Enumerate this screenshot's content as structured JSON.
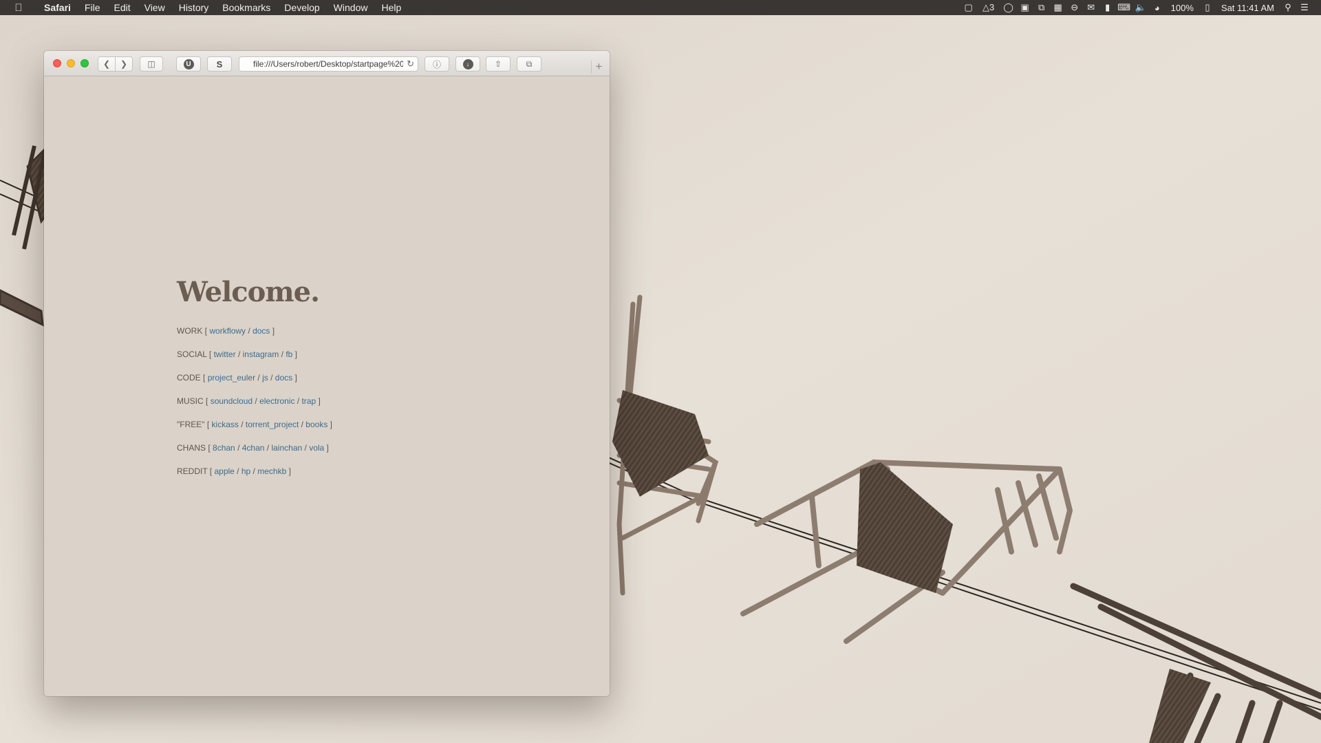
{
  "menubar": {
    "app": "Safari",
    "items": [
      "File",
      "Edit",
      "View",
      "History",
      "Bookmarks",
      "Develop",
      "Window",
      "Help"
    ],
    "status": {
      "badge_count": "3",
      "battery": "100%",
      "clock": "Sat 11:41 AM"
    }
  },
  "browser": {
    "url": "file:///Users/robert/Desktop/startpage%20crea",
    "toolbar_buttons": {
      "ublock": "U",
      "stylebot": "S"
    },
    "new_tab": "+"
  },
  "startpage": {
    "title": "Welcome.",
    "sections": [
      {
        "label": "WORK",
        "links": [
          "workflowy",
          "docs"
        ]
      },
      {
        "label": "SOCIAL",
        "links": [
          "twitter",
          "instagram",
          "fb"
        ]
      },
      {
        "label": "CODE",
        "links": [
          "project_euler",
          "js",
          "docs"
        ]
      },
      {
        "label": "MUSIC",
        "links": [
          "soundcloud",
          "electronic",
          "trap"
        ]
      },
      {
        "label": "\"FREE\"",
        "links": [
          "kickass",
          "torrent_project",
          "books"
        ]
      },
      {
        "label": "CHANS",
        "links": [
          "8chan",
          "4chan",
          "lainchan",
          "vola"
        ]
      },
      {
        "label": "REDDIT",
        "links": [
          "apple",
          "hp",
          "mechkb"
        ]
      }
    ]
  },
  "colors": {
    "link": "#3c6b8f",
    "heading": "#6b5d52",
    "page_bg": "#dbd3c9"
  }
}
